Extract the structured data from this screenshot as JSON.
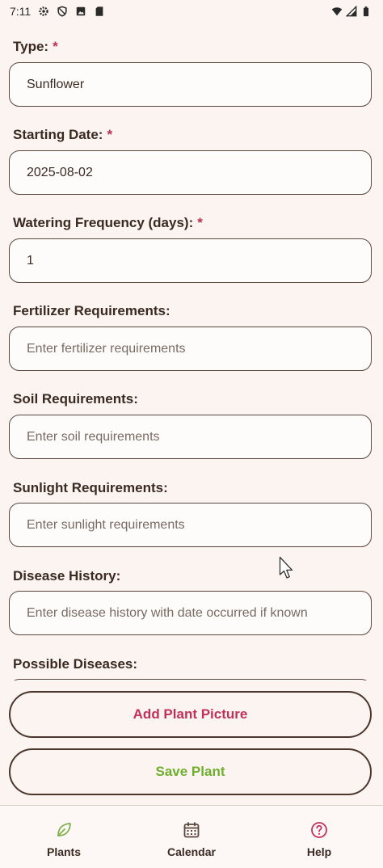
{
  "status_bar": {
    "time": "7:11",
    "icons": [
      "settings-icon",
      "shield-icon",
      "photo-icon",
      "sd-card-icon"
    ],
    "right_icons": [
      "wifi-icon",
      "signal-icon",
      "battery-icon"
    ]
  },
  "form": {
    "fields": [
      {
        "label": "Type:",
        "required": "*",
        "value": "Sunflower",
        "placeholder": ""
      },
      {
        "label": "Starting Date:",
        "required": "*",
        "value": "2025-08-02",
        "placeholder": ""
      },
      {
        "label": "Watering Frequency (days):",
        "required": "*",
        "value": "1",
        "placeholder": ""
      },
      {
        "label": "Fertilizer Requirements:",
        "value": "",
        "placeholder": "Enter fertilizer requirements"
      },
      {
        "label": "Soil Requirements:",
        "value": "",
        "placeholder": "Enter soil requirements"
      },
      {
        "label": "Sunlight Requirements:",
        "value": "",
        "placeholder": "Enter sunlight requirements"
      },
      {
        "label": "Disease History:",
        "value": "",
        "placeholder": "Enter disease history with date occurred if known"
      },
      {
        "label": "Possible Diseases:",
        "value": "",
        "placeholder": ""
      }
    ]
  },
  "buttons": {
    "add_picture": "Add Plant Picture",
    "save": "Save Plant"
  },
  "bottom_nav": {
    "items": [
      {
        "label": "Plants",
        "icon": "leaf-icon"
      },
      {
        "label": "Calendar",
        "icon": "calendar-icon"
      },
      {
        "label": "Help",
        "icon": "help-icon"
      }
    ]
  },
  "colors": {
    "background": "#fbf4f0",
    "required_mark": "#c0304f",
    "add_picture_text": "#c1315a",
    "save_text": "#6fae2f",
    "nav_plants_icon": "#7fb04a",
    "nav_help_icon": "#c1315a",
    "nav_calendar_icon": "#5b463c"
  }
}
